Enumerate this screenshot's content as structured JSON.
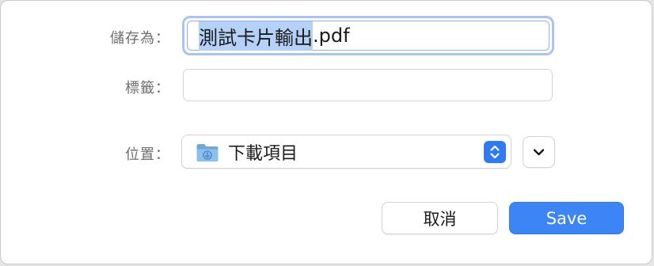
{
  "dialog": {
    "save_as_label": "儲存為：",
    "filename": {
      "selected_part": "測試卡片輸出",
      "extension": ".pdf"
    },
    "tags_label": "標籤：",
    "tags_value": "",
    "location_label": "位置：",
    "location_value": "下載項目",
    "folder_icon": "downloads-folder-icon",
    "cancel_label": "取消",
    "save_label": "Save"
  },
  "colors": {
    "accent": "#3b85f6",
    "focus_ring": "#a8c4f5",
    "selection": "#b5d1f7",
    "label_text": "#6e6e6e"
  }
}
